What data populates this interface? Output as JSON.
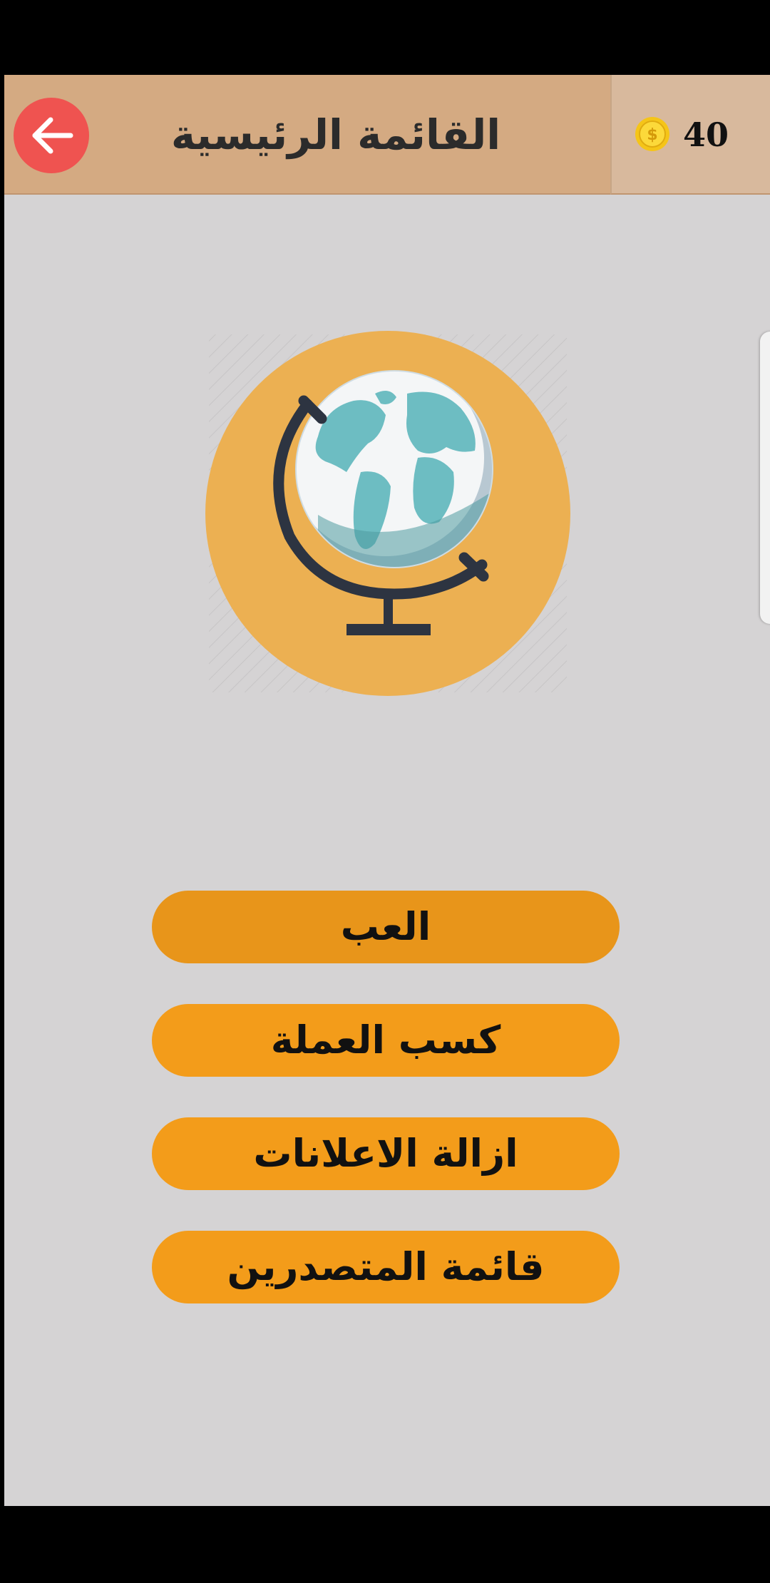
{
  "header": {
    "title": "القائمة الرئيسية",
    "back_icon": "arrow-left-icon",
    "coins": "40",
    "coin_icon": "dollar-coin-icon"
  },
  "logo": {
    "icon": "globe-icon"
  },
  "menu": {
    "items": [
      {
        "label": "العب"
      },
      {
        "label": "كسب العملة"
      },
      {
        "label": "ازالة الاعلانات"
      },
      {
        "label": "قائمة المتصدرين"
      }
    ]
  },
  "colors": {
    "header_bg": "#d4aa82",
    "coins_bg": "#d8b99d",
    "back_button": "#ef5350",
    "screen_bg": "#d5d3d4",
    "button_bg": "#f39c1a",
    "logo_circle": "#ecb052"
  }
}
